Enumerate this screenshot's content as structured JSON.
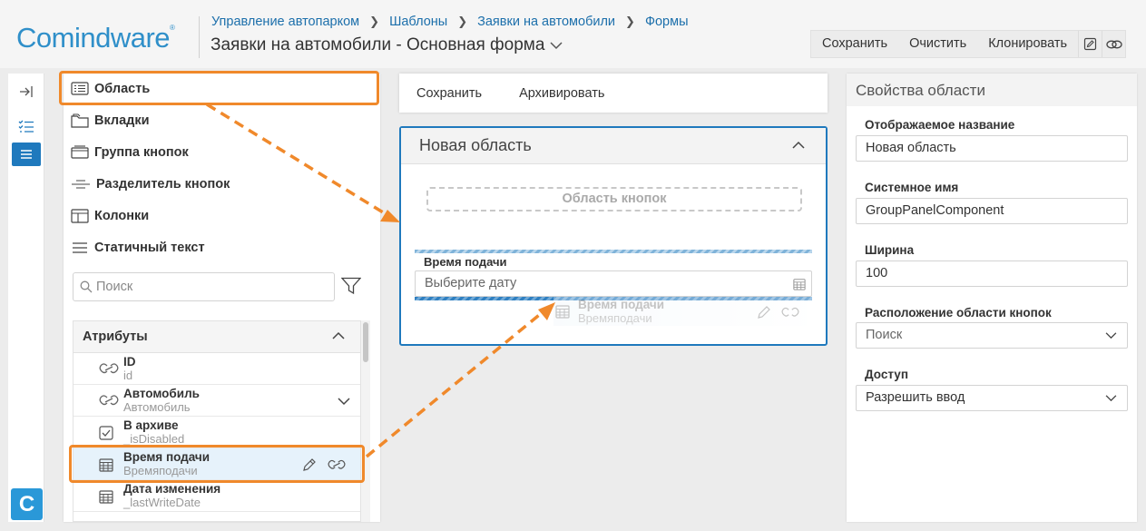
{
  "header": {
    "logo": "Comindware",
    "logo_mark": "®",
    "breadcrumb": [
      "Управление автопарком",
      "Шаблоны",
      "Заявки на автомобили",
      "Формы"
    ],
    "title": "Заявки на автомобили - Основная форма",
    "toolbar": {
      "save": "Сохранить",
      "clear": "Очистить",
      "clone": "Клонировать"
    }
  },
  "rail": {
    "logo_letter": "C"
  },
  "components": {
    "items": [
      "Область",
      "Вкладки",
      "Группа кнопок",
      "Разделитель кнопок",
      "Колонки",
      "Статичный текст"
    ],
    "search_placeholder": "Поиск",
    "attributes_title": "Атрибуты",
    "attributes": [
      {
        "name": "ID",
        "system": "id"
      },
      {
        "name": "Автомобиль",
        "system": "Автомобиль"
      },
      {
        "name": "В архиве",
        "system": "_isDisabled"
      },
      {
        "name": "Время подачи",
        "system": "Времяподачи"
      },
      {
        "name": "Дата изменения",
        "system": "_lastWriteDate"
      }
    ]
  },
  "form": {
    "buttons": [
      "Сохранить",
      "Архивировать"
    ],
    "area_title": "Новая область",
    "button_zone": "Область кнопок",
    "field_label": "Время подачи",
    "field_placeholder": "Выберите дату",
    "ghost_name": "Время подачи",
    "ghost_system": "Времяподачи"
  },
  "properties": {
    "title": "Свойства области",
    "display_name_label": "Отображаемое название",
    "display_name": "Новая область",
    "system_name_label": "Системное имя",
    "system_name": "GroupPanelComponent",
    "width_label": "Ширина",
    "width": "100",
    "button_area_pos_label": "Расположение области кнопок",
    "button_area_pos": "Поиск",
    "access_label": "Доступ",
    "access": "Разрешить ввод"
  },
  "colors": {
    "accent": "#1f79bd",
    "annotation": "#f0892b",
    "logo": "#2f8fc9"
  }
}
